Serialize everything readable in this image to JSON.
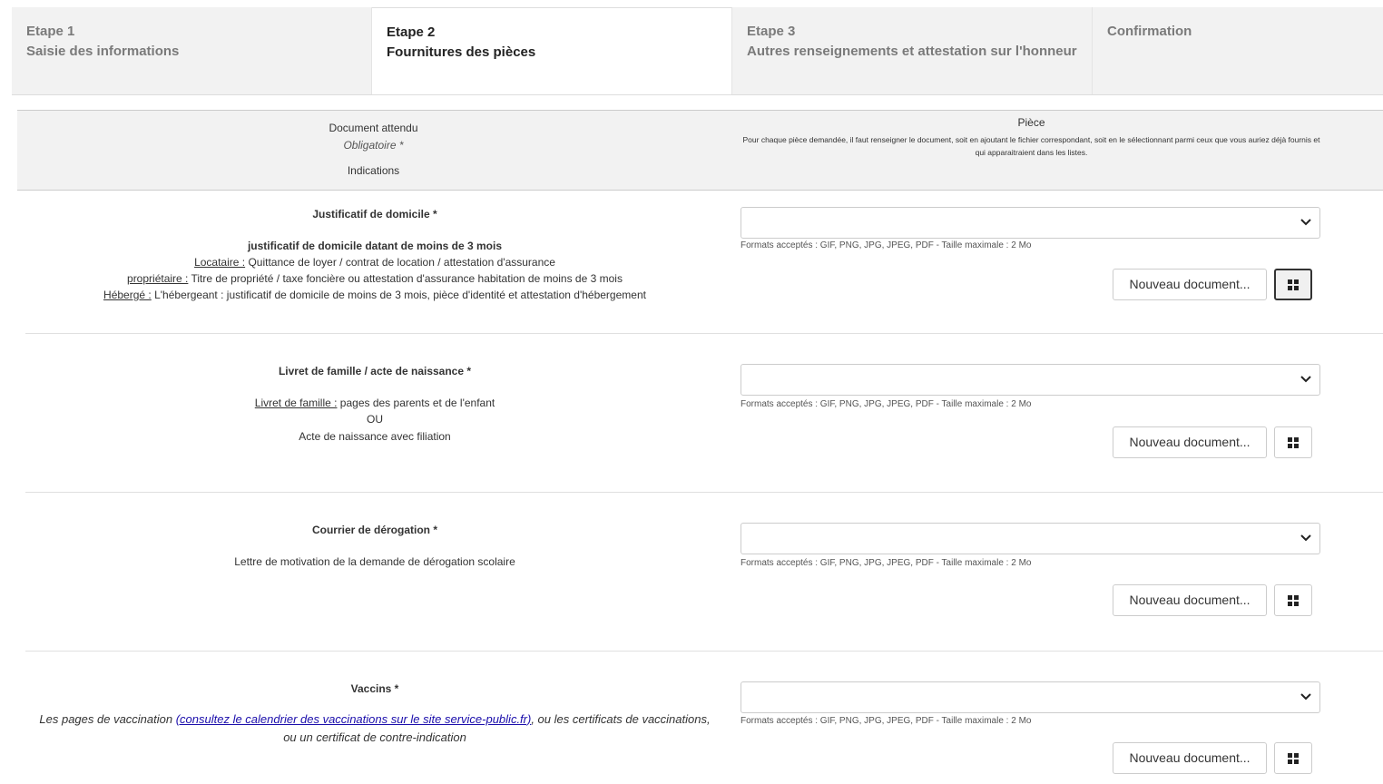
{
  "steps": [
    {
      "num": "Etape 1",
      "label": "Saisie des informations"
    },
    {
      "num": "Etape 2",
      "label": "Fournitures des pièces"
    },
    {
      "num": "Etape 3",
      "label": "Autres renseignements et attestation sur l'honneur"
    },
    {
      "num": "Confirmation",
      "label": ""
    }
  ],
  "table_header": {
    "left_title": "Document attendu",
    "left_required": "Obligatoire *",
    "left_indications": "Indications",
    "right_title": "Pièce",
    "right_help": "Pour chaque pièce demandée, il faut renseigner le document, soit en ajoutant le fichier correspondant, soit en le sélectionnant parmi ceux que vous auriez déjà fournis et qui apparaitraient dans les listes."
  },
  "common": {
    "formats": "Formats acceptés : GIF, PNG, JPG, JPEG, PDF - Taille maximale : 2 Mo",
    "new_document": "Nouveau document..."
  },
  "rows": {
    "domicile": {
      "title": "Justificatif de domicile *",
      "subtitle": "justificatif de domicile datant de moins de 3 mois",
      "l1_u": "Locataire :",
      "l1": " Quittance de loyer / contrat de location / attestation d'assurance",
      "l2_u": "propriétaire :",
      "l2": " Titre de propriété / taxe foncière ou attestation d'assurance habitation de moins de 3 mois",
      "l3_u": "Hébergé :",
      "l3": " L'hébergeant : justificatif de domicile de moins de 3 mois, pièce d'identité et attestation d'hébergement",
      "selected": ""
    },
    "livret": {
      "title": "Livret de famille / acte de naissance *",
      "l1_u": "Livret de famille :",
      "l1": " pages des parents et de l'enfant",
      "l2": "OU",
      "l3": "Acte de naissance avec filiation",
      "selected": ""
    },
    "derogation": {
      "title": "Courrier de dérogation *",
      "l1": "Lettre de motivation de la demande de dérogation scolaire",
      "selected": ""
    },
    "vaccins": {
      "title": "Vaccins *",
      "t1": "Les pages de vaccination ",
      "link": "(consultez le calendrier des vaccinations sur le site service-public.fr)",
      "t2": ", ou les certificats de vaccinations, ou un certificat de contre-indication",
      "selected": ""
    }
  },
  "colors": {
    "header_bg": "#f2f2f2",
    "link": "#1a0dab"
  }
}
